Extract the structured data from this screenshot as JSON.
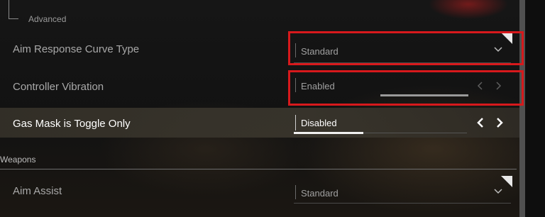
{
  "sections": {
    "advanced": {
      "label": "Advanced"
    },
    "weapons": {
      "label": "Weapons"
    }
  },
  "settings": [
    {
      "label": "Aim Response Curve Type",
      "value": "Standard",
      "control": "dropdown",
      "highlighted": true
    },
    {
      "label": "Controller Vibration",
      "value": "Enabled",
      "control": "arrow-selector",
      "highlighted": true
    },
    {
      "label": "Gas Mask is Toggle Only",
      "value": "Disabled",
      "control": "arrow-selector",
      "selected": true
    },
    {
      "label": "Aim Assist",
      "value": "Standard",
      "control": "dropdown"
    }
  ],
  "colors": {
    "highlight_frame": "#d7191c",
    "selected_row_bg": "#34302a",
    "text_dim": "#a8a8a8",
    "text_bright": "#ffffff"
  },
  "icons": {
    "dropdown": "chevron-down-icon",
    "prev": "chevron-left-icon",
    "next": "chevron-right-icon"
  },
  "sliders": {
    "controller_vibration_fill": 1.0,
    "gas_mask_fill": 0.4
  }
}
